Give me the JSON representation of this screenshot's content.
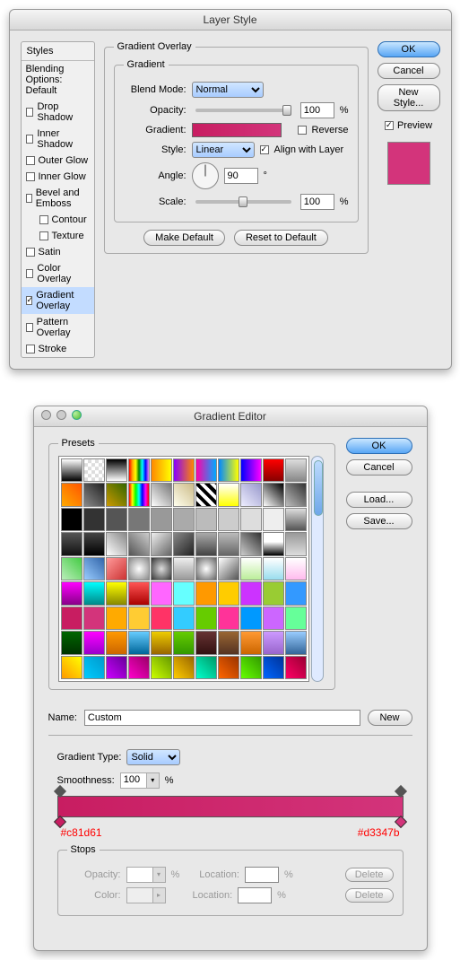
{
  "layerStyle": {
    "title": "Layer Style",
    "stylesHeader": "Styles",
    "blendingHeader": "Blending Options: Default",
    "styles": [
      {
        "label": "Drop Shadow",
        "checked": false
      },
      {
        "label": "Inner Shadow",
        "checked": false
      },
      {
        "label": "Outer Glow",
        "checked": false
      },
      {
        "label": "Inner Glow",
        "checked": false
      },
      {
        "label": "Bevel and Emboss",
        "checked": false
      },
      {
        "label": "Contour",
        "checked": false,
        "indent": true
      },
      {
        "label": "Texture",
        "checked": false,
        "indent": true
      },
      {
        "label": "Satin",
        "checked": false
      },
      {
        "label": "Color Overlay",
        "checked": false
      },
      {
        "label": "Gradient Overlay",
        "checked": true,
        "selected": true
      },
      {
        "label": "Pattern Overlay",
        "checked": false
      },
      {
        "label": "Stroke",
        "checked": false
      }
    ],
    "section": {
      "legend": "Gradient Overlay",
      "sublegend": "Gradient",
      "blendModeLabel": "Blend Mode:",
      "blendMode": "Normal",
      "opacityLabel": "Opacity:",
      "opacity": "100",
      "opacityUnit": "%",
      "gradientLabel": "Gradient:",
      "reverseLabel": "Reverse",
      "reverse": false,
      "styleLabel": "Style:",
      "style": "Linear",
      "alignLabel": "Align with Layer",
      "align": true,
      "angleLabel": "Angle:",
      "angle": "90",
      "angleUnit": "°",
      "scaleLabel": "Scale:",
      "scale": "100",
      "scaleUnit": "%",
      "makeDefault": "Make Default",
      "resetDefault": "Reset to Default"
    },
    "buttons": {
      "ok": "OK",
      "cancel": "Cancel",
      "newStyle": "New Style...",
      "previewLabel": "Preview",
      "preview": true
    }
  },
  "gradientEditor": {
    "title": "Gradient Editor",
    "presetsLegend": "Presets",
    "buttons": {
      "ok": "OK",
      "cancel": "Cancel",
      "load": "Load...",
      "save": "Save...",
      "new": "New"
    },
    "nameLabel": "Name:",
    "name": "Custom",
    "gradTypeLabel": "Gradient Type:",
    "gradType": "Solid",
    "smoothLabel": "Smoothness:",
    "smooth": "100",
    "smoothUnit": "%",
    "leftHex": "#c81d61",
    "rightHex": "#d3347b",
    "stops": {
      "legend": "Stops",
      "opacityLabel": "Opacity:",
      "locationLabel": "Location:",
      "colorLabel": "Color:",
      "pct": "%",
      "delete": "Delete"
    },
    "presetSwatches": [
      "linear-gradient(#fff,#000)",
      "repeating-conic-gradient(#ddd 0 25%,#fff 0 50%) 0/8px 8px",
      "linear-gradient(#000,#fff)",
      "linear-gradient(90deg,red,orange,yellow,green,cyan,blue,violet)",
      "linear-gradient(90deg,#f80,#ff0)",
      "linear-gradient(90deg,#80f,#f80)",
      "linear-gradient(90deg,#f0a,#0af)",
      "linear-gradient(90deg,#08f,#ff0)",
      "linear-gradient(90deg,#00f,#f0f)",
      "linear-gradient(#f00,#800)",
      "linear-gradient(#ddd,#888)",
      "linear-gradient(45deg,#fa0,#f50)",
      "linear-gradient(45deg,#888,#222)",
      "linear-gradient(45deg,#c90,#360)",
      "linear-gradient(90deg,#f00,#ff0,#0f0,#0ff,#00f,#f0f,#f00)",
      "linear-gradient(45deg,#fff,#777)",
      "linear-gradient(45deg,#ffe,#cb8)",
      "repeating-linear-gradient(45deg,#000 0 4px,#fff 4px 8px)",
      "linear-gradient(#fff,#ff0)",
      "linear-gradient(45deg,#eef,#99c)",
      "linear-gradient(45deg,#fff,#000)",
      "linear-gradient(45deg,#bbb,#333)",
      "#000",
      "#333",
      "#555",
      "#777",
      "#999",
      "#aaa",
      "#bbb",
      "#ccc",
      "#ddd",
      "#eee",
      "linear-gradient(#ddd,#555)",
      "linear-gradient(#555,#111)",
      "linear-gradient(#444,#000)",
      "linear-gradient(45deg,#fff,#888)",
      "linear-gradient(45deg,#555,#ccc)",
      "linear-gradient(135deg,#eee,#666)",
      "linear-gradient(135deg,#888,#222)",
      "linear-gradient(#aaa,#444)",
      "linear-gradient(#bbb,#666)",
      "linear-gradient(45deg,#ccc,#333)",
      "linear-gradient(#fff 40%,#000)",
      "linear-gradient(#999,#ddd)",
      "linear-gradient(45deg,#beb,#4c4)",
      "linear-gradient(45deg,#9cf,#36a)",
      "linear-gradient(135deg,#f99,#c33)",
      "radial-gradient(#fff,#888)",
      "radial-gradient(#ddd,#333)",
      "linear-gradient(#eee,#999)",
      "radial-gradient(#fff,#666)",
      "linear-gradient(135deg,#fff,#555)",
      "linear-gradient(#fff,#be9)",
      "linear-gradient(#fff,#9de)",
      "linear-gradient(#fff,#fbe)",
      "linear-gradient(#f0f,#808)",
      "linear-gradient(#0ff,#088)",
      "linear-gradient(#ff0,#880)",
      "linear-gradient(#f55,#a00)",
      "#f6f",
      "#6ff",
      "#f90",
      "#fc0",
      "#c3f",
      "#9c3",
      "#39f",
      "#c81d61",
      "#d3347b",
      "#fa0",
      "#fc3",
      "#f36",
      "#3cf",
      "#6c0",
      "#f39",
      "#09f",
      "#c6f",
      "#6f9",
      "linear-gradient(#060,#030)",
      "linear-gradient(#f0f,#90c)",
      "linear-gradient(#f90,#c60)",
      "linear-gradient(#6cf,#069)",
      "linear-gradient(#ec0,#960)",
      "linear-gradient(#6c0,#390)",
      "linear-gradient(#633,#311)",
      "linear-gradient(#963,#532)",
      "linear-gradient(#f93,#c60)",
      "linear-gradient(#c9f,#96c)",
      "linear-gradient(#9cf,#369)",
      "linear-gradient(45deg,#f90,#ff0)",
      "linear-gradient(45deg,#0cf,#09c)",
      "linear-gradient(45deg,#c0f,#609)",
      "linear-gradient(45deg,#f0c,#906)",
      "linear-gradient(45deg,#cf0,#690)",
      "linear-gradient(45deg,#fc0,#960)",
      "linear-gradient(45deg,#0fc,#096)",
      "linear-gradient(45deg,#f60,#930)",
      "linear-gradient(45deg,#6f0,#390)",
      "linear-gradient(45deg,#06f,#039)",
      "linear-gradient(45deg,#f06,#903)"
    ]
  }
}
